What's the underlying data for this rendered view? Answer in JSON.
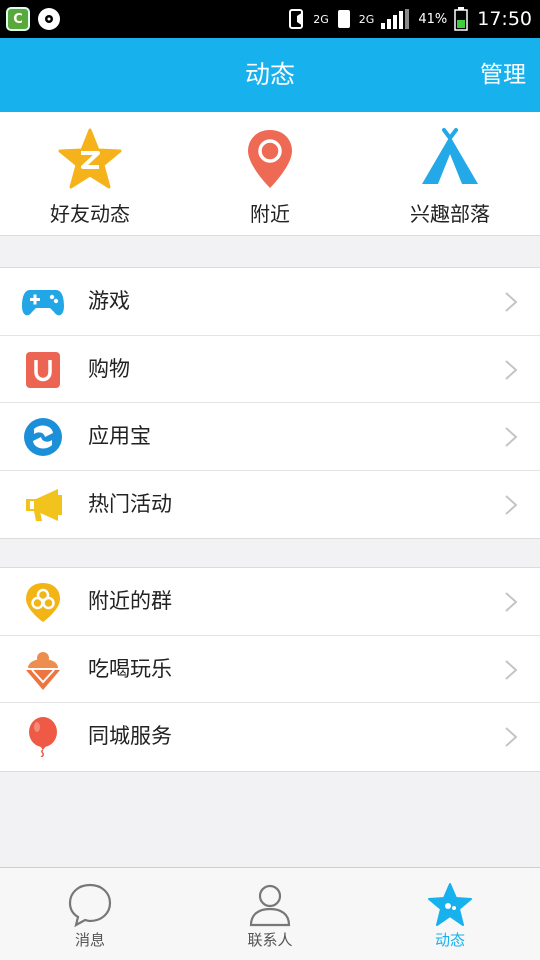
{
  "status_bar": {
    "network_label_1": "2G",
    "network_label_2": "2G",
    "battery_percent": "41%",
    "time": "17:50"
  },
  "header": {
    "title": "动态",
    "manage_label": "管理"
  },
  "top_items": [
    {
      "label": "好友动态",
      "icon": "star-z-icon"
    },
    {
      "label": "附近",
      "icon": "location-pin-icon"
    },
    {
      "label": "兴趣部落",
      "icon": "tent-icon"
    }
  ],
  "group1": [
    {
      "label": "游戏",
      "icon": "gamepad-icon"
    },
    {
      "label": "购物",
      "icon": "shopping-magnet-icon"
    },
    {
      "label": "应用宝",
      "icon": "app-treasure-icon"
    },
    {
      "label": "热门活动",
      "icon": "megaphone-icon"
    }
  ],
  "group2": [
    {
      "label": "附近的群",
      "icon": "nearby-group-icon"
    },
    {
      "label": "吃喝玩乐",
      "icon": "ice-cream-icon"
    },
    {
      "label": "同城服务",
      "icon": "balloon-icon"
    }
  ],
  "bottom_nav": [
    {
      "label": "消息",
      "icon": "chat-bubble-icon",
      "active": false
    },
    {
      "label": "联系人",
      "icon": "contact-person-icon",
      "active": false
    },
    {
      "label": "动态",
      "icon": "star-icon",
      "active": true
    }
  ],
  "colors": {
    "brand_blue": "#17b1ee",
    "star_yellow": "#f5b21a",
    "pin_red": "#ee6a55",
    "tent_blue": "#23a9e8"
  }
}
